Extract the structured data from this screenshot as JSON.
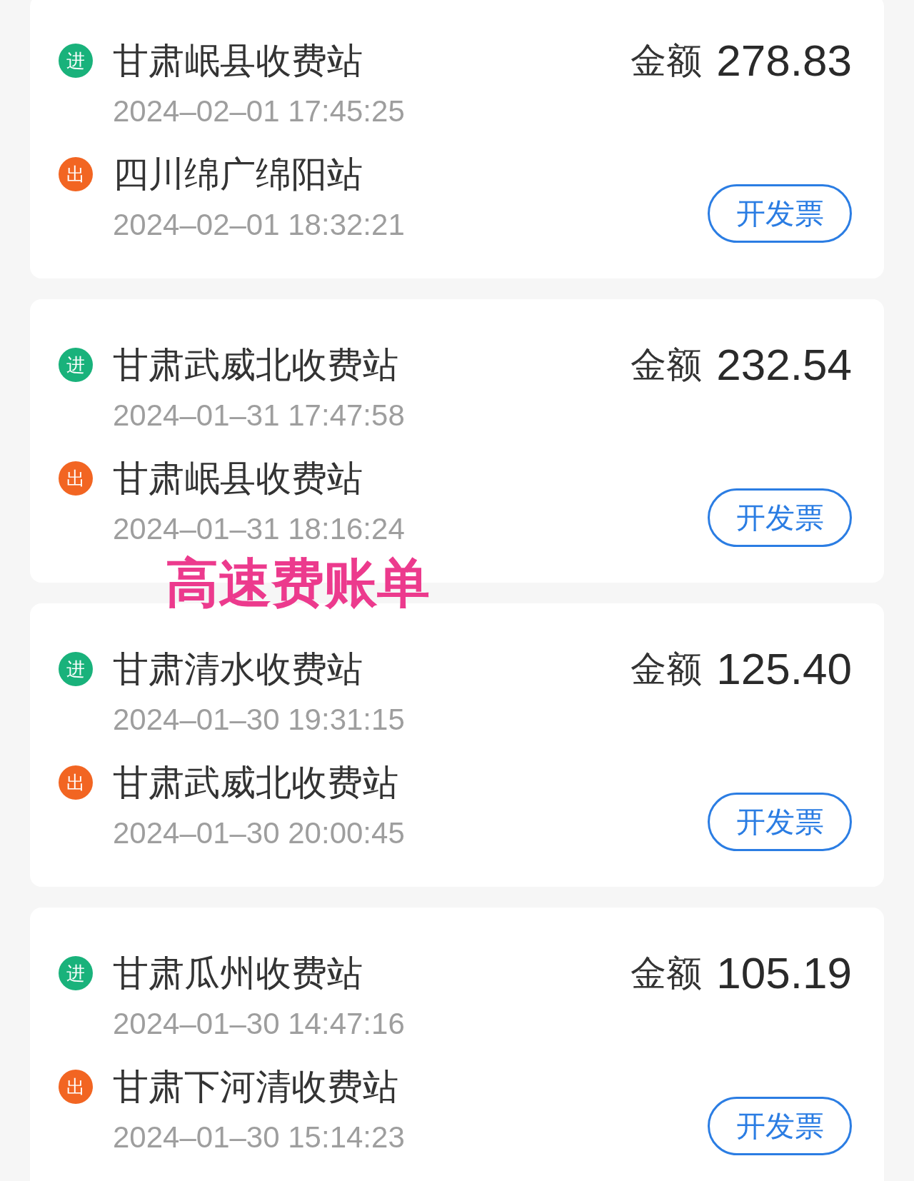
{
  "records": [
    {
      "stops": [
        {
          "kind": "entry",
          "badge": "进",
          "station": "甘肃岷县收费站",
          "time": "2024–02–01 17:45:25"
        },
        {
          "kind": "exit",
          "badge": "出",
          "station": "四川绵广绵阳站",
          "time": "2024–02–01 18:32:21"
        }
      ],
      "amount_label": "金额",
      "amount": "278.83",
      "button": "开发票"
    },
    {
      "stops": [
        {
          "kind": "entry",
          "badge": "进",
          "station": "甘肃武威北收费站",
          "time": "2024–01–31 17:47:58"
        },
        {
          "kind": "exit",
          "badge": "出",
          "station": "甘肃岷县收费站",
          "time": "2024–01–31 18:16:24"
        }
      ],
      "amount_label": "金额",
      "amount": "232.54",
      "button": "开发票"
    },
    {
      "stops": [
        {
          "kind": "entry",
          "badge": "进",
          "station": "甘肃清水收费站",
          "time": "2024–01–30 19:31:15"
        },
        {
          "kind": "exit",
          "badge": "出",
          "station": "甘肃武威北收费站",
          "time": "2024–01–30 20:00:45"
        }
      ],
      "amount_label": "金额",
      "amount": "125.40",
      "button": "开发票"
    },
    {
      "stops": [
        {
          "kind": "entry",
          "badge": "进",
          "station": "甘肃瓜州收费站",
          "time": "2024–01–30 14:47:16"
        },
        {
          "kind": "exit",
          "badge": "出",
          "station": "甘肃下河清收费站",
          "time": "2024–01–30 15:14:23"
        }
      ],
      "amount_label": "金额",
      "amount": "105.19",
      "button": "开发票"
    }
  ],
  "caption": "高速费账单"
}
